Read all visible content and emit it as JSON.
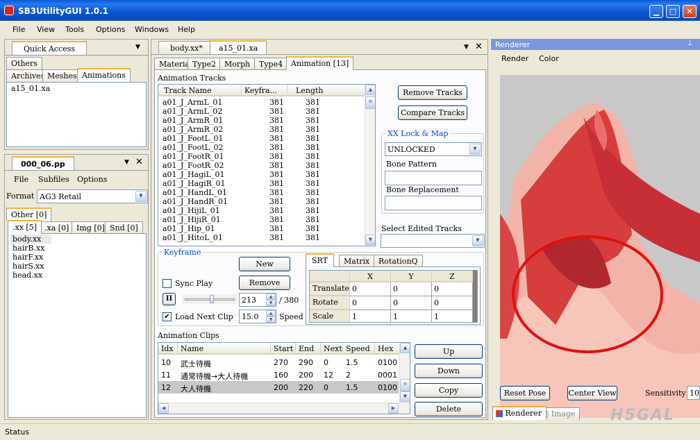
{
  "window": {
    "title": "SB3UtilityGUI 1.0.1"
  },
  "menu": [
    "File",
    "View",
    "Tools",
    "Options",
    "Windows",
    "Help"
  ],
  "left_top": {
    "title": "Quick Access",
    "tabs": [
      "Others",
      "Archives",
      "Meshes",
      "Animations"
    ],
    "items": [
      "a15_01.xa"
    ]
  },
  "left_bottom": {
    "title": "000_06.pp",
    "menu": [
      "File",
      "Subfiles",
      "Options"
    ],
    "format_label": "Format",
    "format_value": "AG3 Retail",
    "tabs_row1": [
      "Other [0]"
    ],
    "tabs_row2": [
      ".xx [5]",
      ".xa [0]",
      "Img [0]",
      "Snd [0]"
    ],
    "files": [
      "body.xx",
      "hairB.xx",
      "hairF.xx",
      "hairS.xx",
      "head.xx"
    ]
  },
  "doc_tabs": [
    "body.xx*",
    "a15_01.xa"
  ],
  "sub_tabs": [
    "Material",
    "Type2",
    "Morph",
    "Type4",
    "Animation [13]"
  ],
  "tracks": {
    "label": "Animation Tracks",
    "headers": [
      "Track Name",
      "Keyfra...",
      "Length"
    ],
    "rows": [
      [
        "a01_J_ArmL_01",
        "381",
        "381"
      ],
      [
        "a01_J_ArmL_02",
        "381",
        "381"
      ],
      [
        "a01_J_ArmR_01",
        "381",
        "381"
      ],
      [
        "a01_J_ArmR_02",
        "381",
        "381"
      ],
      [
        "a01_J_FootL_01",
        "381",
        "381"
      ],
      [
        "a01_J_FootL_02",
        "381",
        "381"
      ],
      [
        "a01_J_FootR_01",
        "381",
        "381"
      ],
      [
        "a01_J_FootR_02",
        "381",
        "381"
      ],
      [
        "a01_J_HagiL_01",
        "381",
        "381"
      ],
      [
        "a01_J_HagiR_01",
        "381",
        "381"
      ],
      [
        "a01_J_HandL_01",
        "381",
        "381"
      ],
      [
        "a01_J_HandR_01",
        "381",
        "381"
      ],
      [
        "a01_J_HijiL_01",
        "381",
        "381"
      ],
      [
        "a01_J_HijiR_01",
        "381",
        "381"
      ],
      [
        "a01_J_Hip_01",
        "381",
        "381"
      ],
      [
        "a01_J_HitoL_01",
        "381",
        "381"
      ]
    ]
  },
  "track_buttons": {
    "remove": "Remove Tracks",
    "compare": "Compare Tracks"
  },
  "xxlock": {
    "title": "XX Lock & Map",
    "value": "UNLOCKED",
    "bone_pattern": "Bone Pattern",
    "bone_replacement": "Bone Replacement",
    "select_edited": "Select Edited Tracks"
  },
  "keyframe": {
    "title": "Keyframe",
    "new": "New",
    "remove": "Remove",
    "sync_play": "Sync Play",
    "frame": "213",
    "total": "/ 380",
    "load_next": "Load Next Clip",
    "speed_value": "15.0",
    "speed_label": "Speed",
    "pause": "II"
  },
  "srt": {
    "tabs": [
      "SRT",
      "Matrix",
      "RotationQ"
    ],
    "cols": [
      "X",
      "Y",
      "Z"
    ],
    "rows": [
      [
        "Translate",
        "0",
        "0",
        "0"
      ],
      [
        "Rotate",
        "0",
        "0",
        "0"
      ],
      [
        "Scale",
        "1",
        "1",
        "1"
      ]
    ]
  },
  "clips": {
    "label": "Animation Clips",
    "headers": [
      "Idx",
      "Name",
      "Start",
      "End",
      "Next",
      "Speed",
      "Hex"
    ],
    "rows": [
      [
        "10",
        "武士待機",
        "270",
        "290",
        "0",
        "1.5",
        "0100"
      ],
      [
        "11",
        "通常待機→大人待機",
        "160",
        "200",
        "12",
        "2",
        "0001"
      ],
      [
        "12",
        "大人待機",
        "200",
        "220",
        "0",
        "1.5",
        "0100"
      ]
    ],
    "buttons": [
      "Up",
      "Down",
      "Copy",
      "Delete"
    ]
  },
  "renderer": {
    "title": "Renderer",
    "menu": [
      "Render",
      "Color"
    ],
    "reset": "Reset Pose",
    "center": "Center View",
    "sensitivity": "Sensitivity",
    "sens_value": "10",
    "tabs": [
      "Renderer",
      "Image"
    ],
    "watermark": "H5GAL"
  },
  "status": "Status",
  "colors": {
    "titlebar": "#0a5ad8",
    "accent_tab": "#f3b541",
    "circle": "#e01010",
    "viewport": "#c8c8c8"
  }
}
